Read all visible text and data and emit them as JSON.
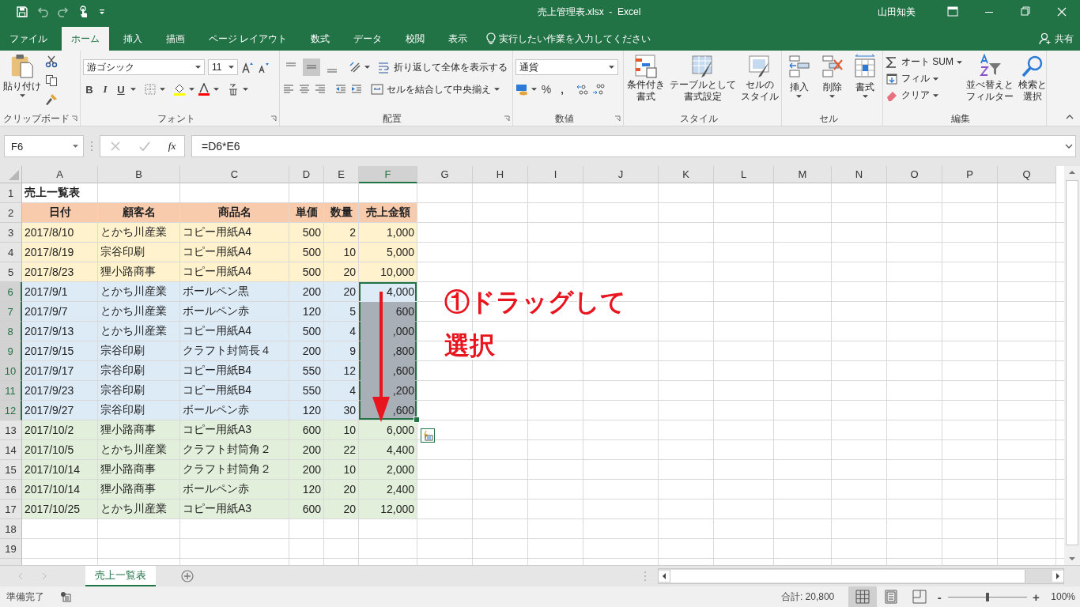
{
  "window": {
    "title": "売上管理表.xlsx  -  Excel",
    "user": "山田知美"
  },
  "tabs": [
    {
      "label": "ファイル",
      "selected": false
    },
    {
      "label": "ホーム",
      "selected": true
    },
    {
      "label": "挿入",
      "selected": false
    },
    {
      "label": "描画",
      "selected": false
    },
    {
      "label": "ページ レイアウト",
      "selected": false
    },
    {
      "label": "数式",
      "selected": false
    },
    {
      "label": "データ",
      "selected": false
    },
    {
      "label": "校閲",
      "selected": false
    },
    {
      "label": "表示",
      "selected": false
    }
  ],
  "tell_me": {
    "placeholder": "実行したい作業を入力してください"
  },
  "share": "共有",
  "ribbon": {
    "clipboard": {
      "label": "クリップボード",
      "paste": "貼り付け"
    },
    "font": {
      "label": "フォント",
      "font_name": "游ゴシック",
      "font_size": "11",
      "bold": "B",
      "italic": "I",
      "underline": "U"
    },
    "alignment": {
      "label": "配置",
      "wrap": "折り返して全体を表示する",
      "merge": "セルを結合して中央揃え",
      "vertical": [
        {
          "selected": false
        },
        {
          "selected": true
        },
        {
          "selected": false
        }
      ]
    },
    "number": {
      "label": "数値",
      "format": "通貨",
      "percent": "%",
      "comma": ","
    },
    "styles": {
      "label": "スタイル",
      "buttons": [
        {
          "lines": [
            "条件付き",
            "書式"
          ]
        },
        {
          "lines": [
            "テーブルとして",
            "書式設定"
          ]
        },
        {
          "lines": [
            "セルの",
            "スタイル"
          ]
        }
      ]
    },
    "cells": {
      "label": "セル",
      "buttons": [
        {
          "label": "挿入"
        },
        {
          "label": "削除"
        },
        {
          "label": "書式"
        }
      ]
    },
    "editing": {
      "label": "編集",
      "autosum": "オート SUM",
      "fill": "フィル",
      "clear": "クリア",
      "buttons": [
        {
          "lines": [
            "並べ替えと",
            "フィルター"
          ]
        },
        {
          "lines": [
            "検索と",
            "選択"
          ]
        }
      ]
    }
  },
  "formula_bar": {
    "name_box": "F6",
    "function_label": "fx",
    "formula": "=D6*E6"
  },
  "columns": [
    {
      "label": "A",
      "selected": false
    },
    {
      "label": "B",
      "selected": false
    },
    {
      "label": "C",
      "selected": false
    },
    {
      "label": "D",
      "selected": false
    },
    {
      "label": "E",
      "selected": false
    },
    {
      "label": "F",
      "selected": true
    },
    {
      "label": "G",
      "selected": false
    },
    {
      "label": "H",
      "selected": false
    },
    {
      "label": "I",
      "selected": false
    },
    {
      "label": "J",
      "selected": false
    },
    {
      "label": "K",
      "selected": false
    },
    {
      "label": "L",
      "selected": false
    },
    {
      "label": "M",
      "selected": false
    },
    {
      "label": "N",
      "selected": false
    },
    {
      "label": "O",
      "selected": false
    },
    {
      "label": "P",
      "selected": false
    },
    {
      "label": "Q",
      "selected": false
    }
  ],
  "rows": [
    {
      "header": "1",
      "kind": "title",
      "selected": false,
      "cells": [
        "売上一覧表"
      ]
    },
    {
      "header": "2",
      "kind": "header",
      "color": "#f8cbad",
      "selected": false,
      "cells": [
        "日付",
        "顧客名",
        "商品名",
        "単価",
        "数量",
        "売上金額"
      ]
    },
    {
      "header": "3",
      "kind": "data",
      "color": "#fff2cc",
      "selected": false,
      "cells": [
        "2017/8/10",
        "とかち川産業",
        "コピー用紙A4",
        "500",
        "2",
        "1,000"
      ]
    },
    {
      "header": "4",
      "kind": "data",
      "color": "#fff2cc",
      "selected": false,
      "cells": [
        "2017/8/19",
        "宗谷印刷",
        "コピー用紙A4",
        "500",
        "10",
        "5,000"
      ]
    },
    {
      "header": "5",
      "kind": "data",
      "color": "#fff2cc",
      "selected": false,
      "cells": [
        "2017/8/23",
        "狸小路商事",
        "コピー用紙A4",
        "500",
        "20",
        "10,000"
      ]
    },
    {
      "header": "6",
      "kind": "data",
      "color": "#ddebf7",
      "selected": true,
      "cells": [
        "2017/9/1",
        "とかち川産業",
        "ボールペン黒",
        "200",
        "20",
        "4,000"
      ]
    },
    {
      "header": "7",
      "kind": "data",
      "color": "#ddebf7",
      "selected": true,
      "cells": [
        "2017/9/7",
        "とかち川産業",
        "ボールペン赤",
        "120",
        "5",
        "600"
      ]
    },
    {
      "header": "8",
      "kind": "data",
      "color": "#ddebf7",
      "selected": true,
      "cells": [
        "2017/9/13",
        "とかち川産業",
        "コピー用紙A4",
        "500",
        "4",
        ",000"
      ]
    },
    {
      "header": "9",
      "kind": "data",
      "color": "#ddebf7",
      "selected": true,
      "cells": [
        "2017/9/15",
        "宗谷印刷",
        "クラフト封筒長４",
        "200",
        "9",
        ",800"
      ]
    },
    {
      "header": "10",
      "kind": "data",
      "color": "#ddebf7",
      "selected": true,
      "cells": [
        "2017/9/17",
        "宗谷印刷",
        "コピー用紙B4",
        "550",
        "12",
        ",600"
      ]
    },
    {
      "header": "11",
      "kind": "data",
      "color": "#ddebf7",
      "selected": true,
      "cells": [
        "2017/9/23",
        "宗谷印刷",
        "コピー用紙B4",
        "550",
        "4",
        ",200"
      ]
    },
    {
      "header": "12",
      "kind": "data",
      "color": "#ddebf7",
      "selected": true,
      "cells": [
        "2017/9/27",
        "宗谷印刷",
        "ボールペン赤",
        "120",
        "30",
        ",600"
      ]
    },
    {
      "header": "13",
      "kind": "data",
      "color": "#e2efda",
      "selected": false,
      "cells": [
        "2017/10/2",
        "狸小路商事",
        "コピー用紙A3",
        "600",
        "10",
        "6,000"
      ]
    },
    {
      "header": "14",
      "kind": "data",
      "color": "#e2efda",
      "selected": false,
      "cells": [
        "2017/10/5",
        "とかち川産業",
        "クラフト封筒角２",
        "200",
        "22",
        "4,400"
      ]
    },
    {
      "header": "15",
      "kind": "data",
      "color": "#e2efda",
      "selected": false,
      "cells": [
        "2017/10/14",
        "狸小路商事",
        "クラフト封筒角２",
        "200",
        "10",
        "2,000"
      ]
    },
    {
      "header": "16",
      "kind": "data",
      "color": "#e2efda",
      "selected": false,
      "cells": [
        "2017/10/14",
        "狸小路商事",
        "ボールペン赤",
        "120",
        "20",
        "2,400"
      ]
    },
    {
      "header": "17",
      "kind": "data",
      "color": "#e2efda",
      "selected": false,
      "cells": [
        "2017/10/25",
        "とかち川産業",
        "コピー用紙A3",
        "600",
        "20",
        "12,000"
      ]
    },
    {
      "header": "18",
      "kind": "empty",
      "selected": false,
      "cells": []
    },
    {
      "header": "19",
      "kind": "empty",
      "selected": false,
      "cells": []
    }
  ],
  "annotation": {
    "lines": [
      "①ドラッグして",
      "選択"
    ]
  },
  "sheet_tabs": [
    {
      "label": "売上一覧表",
      "selected": true
    }
  ],
  "status_bar": {
    "ready": "準備完了",
    "sum": "合計: 20,800",
    "views": [
      {
        "kind": "normal",
        "selected": true
      },
      {
        "kind": "page_layout",
        "selected": false
      },
      {
        "kind": "page_break",
        "selected": false
      }
    ],
    "zoom_out": "-",
    "zoom_in": "+",
    "zoom_slider": {
      "level": 0.5
    },
    "zoom": "100%"
  }
}
